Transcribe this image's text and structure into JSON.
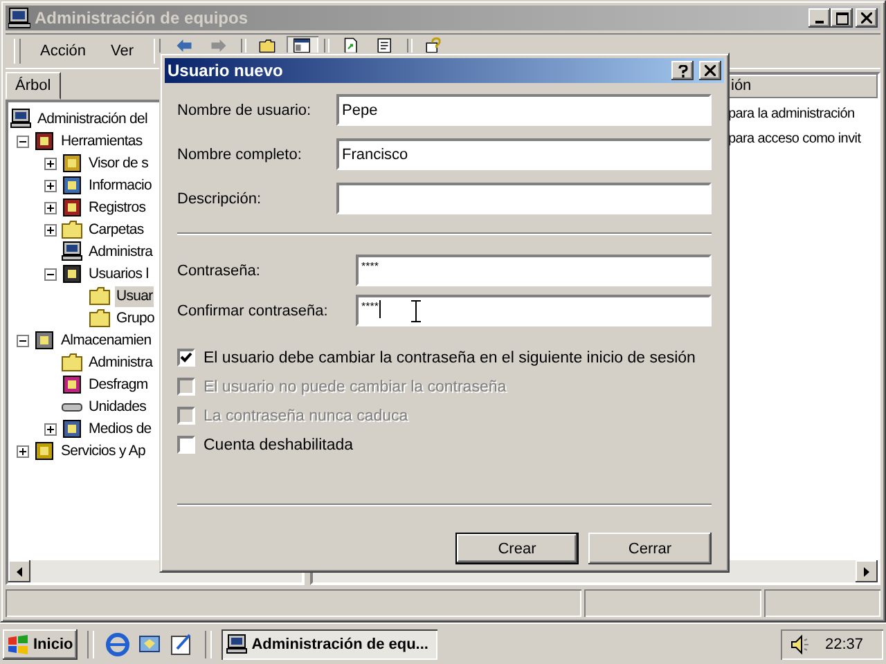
{
  "window": {
    "title": "Administración de equipos"
  },
  "menu": [
    "Acción",
    "Ver"
  ],
  "tree_tab": {
    "label": "Árbol",
    "selected": true
  },
  "tree": [
    {
      "label": "Administración del",
      "kind": "computer",
      "selected": false,
      "children": [
        {
          "label": "Herramientas",
          "kind": "tools",
          "expanded": true,
          "selected": false,
          "children": [
            {
              "label": "Visor de s",
              "kind": "viewer",
              "expanded": false,
              "selected": false
            },
            {
              "label": "Informacio",
              "kind": "info",
              "expanded": false,
              "selected": false
            },
            {
              "label": "Registros",
              "kind": "log",
              "expanded": false,
              "selected": false
            },
            {
              "label": "Carpetas",
              "kind": "folder",
              "expanded": false,
              "selected": false
            },
            {
              "label": "Administra",
              "kind": "computer",
              "selected": false
            },
            {
              "label": "Usuarios l",
              "kind": "users",
              "expanded": true,
              "selected": false,
              "children": [
                {
                  "label": "Usuar",
                  "kind": "folder",
                  "selected": true
                },
                {
                  "label": "Grupo",
                  "kind": "folder",
                  "selected": false
                }
              ]
            }
          ]
        },
        {
          "label": "Almacenamien",
          "kind": "storage",
          "expanded": true,
          "selected": false,
          "children": [
            {
              "label": "Administra",
              "kind": "folder",
              "selected": false
            },
            {
              "label": "Desfragm",
              "kind": "defrag",
              "selected": false
            },
            {
              "label": "Unidades",
              "kind": "drive",
              "selected": false
            },
            {
              "label": "Medios de",
              "kind": "media",
              "expanded": false,
              "selected": false
            }
          ]
        },
        {
          "label": "Servicios y Ap",
          "kind": "services",
          "expanded": false,
          "selected": false
        }
      ]
    }
  ],
  "details": {
    "column_1": "ión",
    "rows": [
      "para la administración",
      "para acceso como invit"
    ]
  },
  "dialog": {
    "title": "Usuario nuevo",
    "fields": [
      {
        "label": "Nombre de usuario:",
        "value": "Pepe"
      },
      {
        "label": "Nombre completo:",
        "value": "Francisco"
      },
      {
        "label": "Descripción:"
      }
    ],
    "password_fields": [
      {
        "label": "Contraseña:",
        "value": "****"
      },
      {
        "label": "Confirmar contraseña:",
        "value": "****"
      }
    ],
    "options": [
      {
        "label": "El usuario debe cambiar la contraseña en el siguiente inicio de sesión",
        "checked": true,
        "disabled": false
      },
      {
        "label": "El usuario no puede cambiar la contraseña",
        "checked": false,
        "disabled": true
      },
      {
        "label": "La contraseña nunca caduca",
        "checked": false,
        "disabled": true
      },
      {
        "label": "Cuenta deshabilitada",
        "checked": false,
        "disabled": false
      }
    ],
    "buttons": [
      {
        "label": "Crear",
        "default": true
      },
      {
        "label": "Cerrar",
        "default": false
      }
    ]
  },
  "taskbar": {
    "start": "Inicio",
    "task": {
      "label": "Administración de equ...",
      "selected": true
    },
    "clock": "22:37"
  }
}
